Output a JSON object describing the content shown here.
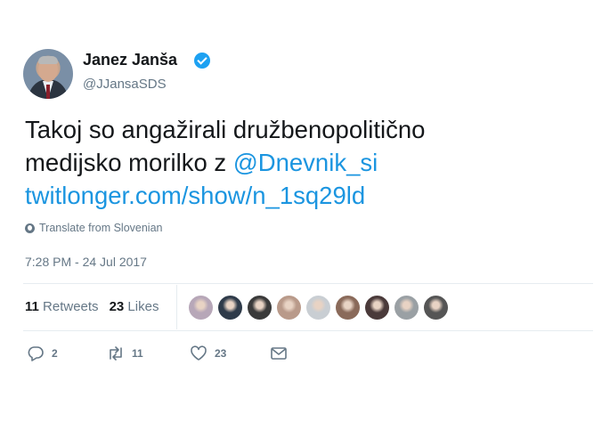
{
  "author": {
    "name": "Janez Janša",
    "handle": "@JJansaSDS",
    "verified": true
  },
  "tweet": {
    "line1": "Takoj so angažirali družbenopolitično",
    "line2_text": "medijsko morilko z ",
    "mention": "@Dnevnik_si",
    "url": "twitlonger.com/show/n_1sq29ld"
  },
  "translate_label": "Translate from Slovenian",
  "timestamp": "7:28 PM - 24 Jul 2017",
  "stats": {
    "retweets_count": "11",
    "retweets_label": "Retweets",
    "likes_count": "23",
    "likes_label": "Likes"
  },
  "liker_avatars": [
    {
      "color": "#b7a7b8"
    },
    {
      "color": "#2f3b4a"
    },
    {
      "color": "#3a3a3a"
    },
    {
      "color": "#b99a8a"
    },
    {
      "color": "#c9ced3"
    },
    {
      "color": "#8a6a5a"
    },
    {
      "color": "#4a3a3a"
    },
    {
      "color": "#9aa0a4"
    },
    {
      "color": "#555555"
    }
  ],
  "actions": {
    "reply_count": "2",
    "retweet_count": "11",
    "like_count": "23"
  },
  "colors": {
    "link": "#1b95e0",
    "verified": "#1da1f2",
    "muted": "#657786",
    "divider": "#e6ecf0"
  },
  "icons": [
    "verified-icon",
    "globe-icon",
    "reply-icon",
    "retweet-icon",
    "like-icon",
    "message-icon"
  ]
}
